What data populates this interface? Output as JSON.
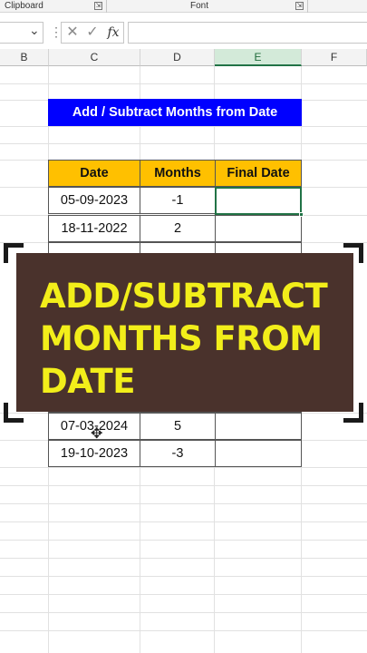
{
  "ribbon": {
    "clipboard_label": "Clipboard",
    "font_label": "Font",
    "launcher_icon": "dialog-launcher-icon"
  },
  "formula_bar": {
    "name_box_value": "",
    "cancel_icon": "✕",
    "enter_icon": "✓",
    "fx_label": "fx",
    "formula_value": ""
  },
  "columns": [
    "B",
    "C",
    "D",
    "E",
    "F"
  ],
  "selected_column": "E",
  "sheet": {
    "title": "Add / Subtract Months from Date",
    "headers": [
      "Date",
      "Months",
      "Final Date"
    ],
    "rows": [
      {
        "date": "05-09-2023",
        "months": "-1",
        "final": ""
      },
      {
        "date": "18-11-2022",
        "months": "2",
        "final": ""
      },
      {
        "date": "07-03-2024",
        "months": "5",
        "final": ""
      },
      {
        "date": "19-10-2023",
        "months": "-3",
        "final": ""
      }
    ]
  },
  "overlay": {
    "line1": "ADD/SUBTRACT",
    "line2": "MONTHS FROM",
    "line3": "DATE"
  },
  "colors": {
    "title_bg": "#0000ff",
    "header_bg": "#ffc000",
    "overlay_bg": "#4a322c",
    "overlay_text": "#f2ee1a",
    "selection": "#217346"
  }
}
